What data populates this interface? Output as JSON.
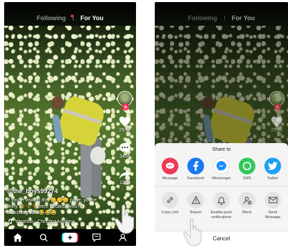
{
  "top_tabs": {
    "following": "Following",
    "for_you": "For You"
  },
  "video": {
    "handle": "@the_boys99274",
    "caption_line1": "If you're visiting this 🙃🙃🙃 page, you're",
    "caption_line2": "likely 🤸🤸🤸 here because you're",
    "caption_line3": "searching #21 😂😂😂",
    "music": "Woohoo - ChristinaAguilera",
    "likes": "25.3k",
    "comments": "3456",
    "shares": "1256",
    "comments_right": "3456",
    "likes_right": "25.3k"
  },
  "share_sheet": {
    "title": "Share to",
    "targets": [
      {
        "label": "Message",
        "icon": "message-icon",
        "color": "#ee3a57"
      },
      {
        "label": "Facebook",
        "icon": "facebook-icon",
        "color": "#1877f2"
      },
      {
        "label": "Messenger",
        "icon": "messenger-icon",
        "color": "#1a8cff"
      },
      {
        "label": "SMS",
        "icon": "sms-icon",
        "color": "#33c85a"
      },
      {
        "label": "Twitter",
        "icon": "twitter-icon",
        "color": "#1da1f2"
      }
    ],
    "actions": [
      {
        "label": "Copy Link",
        "icon": "link-icon"
      },
      {
        "label": "Report",
        "icon": "warning-icon"
      },
      {
        "label": "Enable push notifications",
        "icon": "bell-icon"
      },
      {
        "label": "Block",
        "icon": "block-user-icon"
      },
      {
        "label": "Send Message",
        "icon": "envelope-icon"
      }
    ],
    "cancel": "Cancel"
  },
  "colors": {
    "accent": "#fe2c55",
    "cyan": "#25f4ee"
  }
}
